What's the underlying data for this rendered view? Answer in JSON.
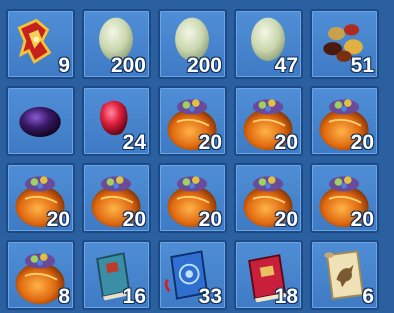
{
  "inventory": {
    "slots": [
      {
        "icon": "red-gold-emblem-icon",
        "count": "9"
      },
      {
        "icon": "jade-egg-icon",
        "count": "200"
      },
      {
        "icon": "jade-egg-icon",
        "count": "200"
      },
      {
        "icon": "jade-egg-icon",
        "count": "47"
      },
      {
        "icon": "gemstones-pile-icon",
        "count": "51"
      },
      {
        "icon": "dark-purple-gem-icon",
        "count": ""
      },
      {
        "icon": "red-ruby-icon",
        "count": "24"
      },
      {
        "icon": "treasure-bag-icon",
        "count": "20"
      },
      {
        "icon": "treasure-bag-icon",
        "count": "20"
      },
      {
        "icon": "treasure-bag-icon",
        "count": "20"
      },
      {
        "icon": "treasure-bag-icon",
        "count": "20"
      },
      {
        "icon": "treasure-bag-icon",
        "count": "20"
      },
      {
        "icon": "treasure-bag-icon",
        "count": "20"
      },
      {
        "icon": "treasure-bag-icon",
        "count": "20"
      },
      {
        "icon": "treasure-bag-icon",
        "count": "20"
      },
      {
        "icon": "treasure-bag-icon",
        "count": "8"
      },
      {
        "icon": "teal-book-icon",
        "count": "16"
      },
      {
        "icon": "blue-magic-book-icon",
        "count": "33"
      },
      {
        "icon": "red-book-icon",
        "count": "18"
      },
      {
        "icon": "horse-scroll-icon",
        "count": "6"
      }
    ]
  },
  "colors": {
    "slot_bg": "#4a89d2",
    "slot_border": "#1d4a85",
    "count_text": "#ffffff"
  }
}
